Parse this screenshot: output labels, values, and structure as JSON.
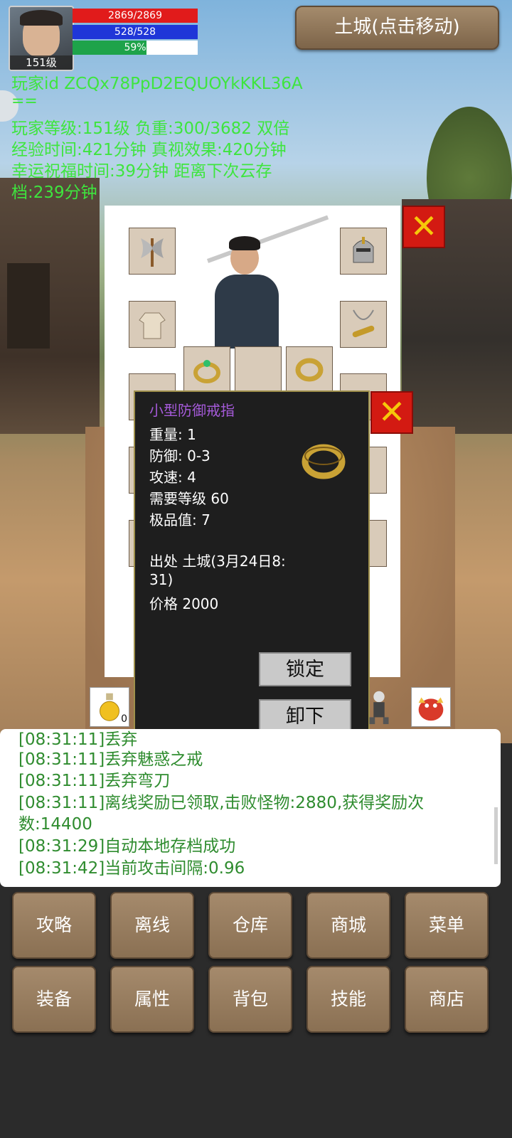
{
  "player": {
    "level_badge": "151级",
    "hp": "2869/2869",
    "mp": "528/528",
    "exp_text": "59%",
    "exp_fraction": 0.59,
    "id_line": "玩家id ZCQx78PpD2EQUOYkKKL36A",
    "eq_line": "==",
    "stats_lines": [
      "玩家等级:151级 负重:300/3682 双倍",
      "经验时间:421分钟 真视效果:420分钟",
      "幸运祝福时间:39分钟 距离下次云存",
      "档:239分钟"
    ]
  },
  "location_button": "土城(点击移动)",
  "panel": {
    "close_glyph": "✕",
    "underlay_lock": "锁定"
  },
  "tooltip": {
    "name": "小型防御戒指",
    "lines": [
      "重量: 1",
      "防御: 0-3",
      "攻速: 4",
      "需要等级 60",
      "极品值: 7",
      "",
      "出处 土城(3月24日8:",
      "31)",
      "价格 2000"
    ],
    "lock_button": "锁定",
    "unequip_button": "卸下",
    "close_glyph": "✕"
  },
  "quickbar": {
    "potion_count": "0"
  },
  "log": [
    "[08:31:11]丢弃",
    "[08:31:11]丢弃魅惑之戒",
    "[08:31:11]丢弃弯刀",
    "[08:31:11]离线奖励已领取,击败怪物:2880,获得奖励次",
    "数:14400",
    "[08:31:29]自动本地存档成功",
    "[08:31:42]当前攻击间隔:0.96"
  ],
  "menu": {
    "row1": [
      "攻略",
      "离线",
      "仓库",
      "商城",
      "菜单"
    ],
    "row2": [
      "装备",
      "属性",
      "背包",
      "技能",
      "商店"
    ]
  },
  "colors": {
    "hp": "#e11b1b",
    "mp": "#1f36d8",
    "exp": "#1ea34a",
    "info_text": "#3ee53e",
    "item_name": "#a55ad9",
    "log_text": "#2f8c2f"
  }
}
